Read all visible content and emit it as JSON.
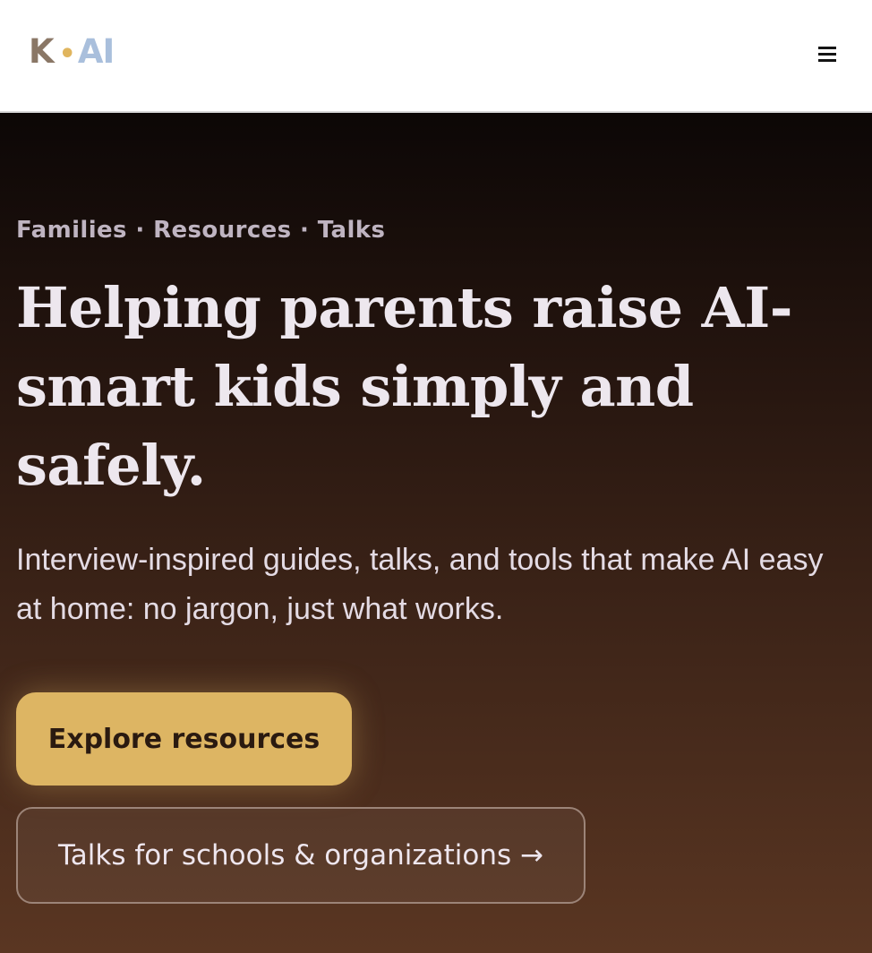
{
  "header": {
    "logo": {
      "k": "K",
      "dot": "•",
      "ai": "AI"
    },
    "menu_icon": "hamburger-menu-icon"
  },
  "hero": {
    "eyebrow": "Families · Resources · Talks",
    "headline": "Helping parents raise AI-smart kids simply and safely.",
    "subtext": "Interview-inspired guides, talks, and tools that make AI easy at home: no jargon, just what works.",
    "primary_button": "Explore resources",
    "secondary_button": "Talks for schools & organizations →"
  },
  "colors": {
    "accent": "#ddb563",
    "logo_k": "#8a7766",
    "logo_ai": "#a9bfdc",
    "hero_top": "#0c0706",
    "hero_bottom": "#5a3622"
  }
}
